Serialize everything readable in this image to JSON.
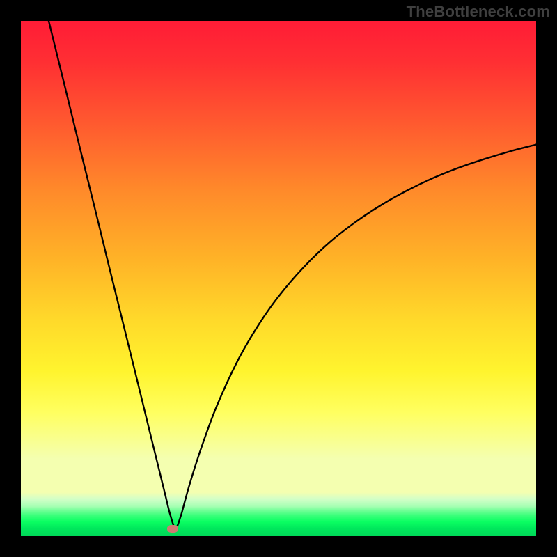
{
  "watermark": "TheBottleneck.com",
  "colors": {
    "frame": "#000000",
    "gradient_top": "#ff1c36",
    "gradient_bottom": "#00d858",
    "curve": "#000000",
    "dot": "#cf7b72",
    "watermark_text": "#3f3f3f"
  },
  "chart_data": {
    "type": "line",
    "title": "",
    "xlabel": "",
    "ylabel": "",
    "xlim": [
      0,
      100
    ],
    "ylim": [
      0,
      100
    ],
    "grid": false,
    "legend": false,
    "annotations": [],
    "marker": {
      "x": 29.5,
      "y": 1.5
    },
    "series": [
      {
        "name": "curve",
        "x": [
          5.4,
          7,
          9,
          11,
          13,
          15,
          17,
          19,
          21,
          23,
          25,
          26.5,
          28,
          29,
          30,
          31,
          32,
          33,
          35,
          38,
          42,
          46,
          50,
          55,
          60,
          65,
          70,
          75,
          80,
          85,
          90,
          95,
          100
        ],
        "y": [
          100,
          93.5,
          85.4,
          77.2,
          69.1,
          61,
          52.8,
          44.7,
          36.6,
          28.5,
          20.3,
          14.2,
          8.1,
          4.1,
          1.6,
          3.8,
          7.4,
          10.9,
          17.1,
          25.2,
          33.9,
          40.8,
          46.5,
          52.3,
          57.1,
          61,
          64.3,
          67.1,
          69.5,
          71.5,
          73.2,
          74.7,
          76
        ]
      }
    ]
  }
}
